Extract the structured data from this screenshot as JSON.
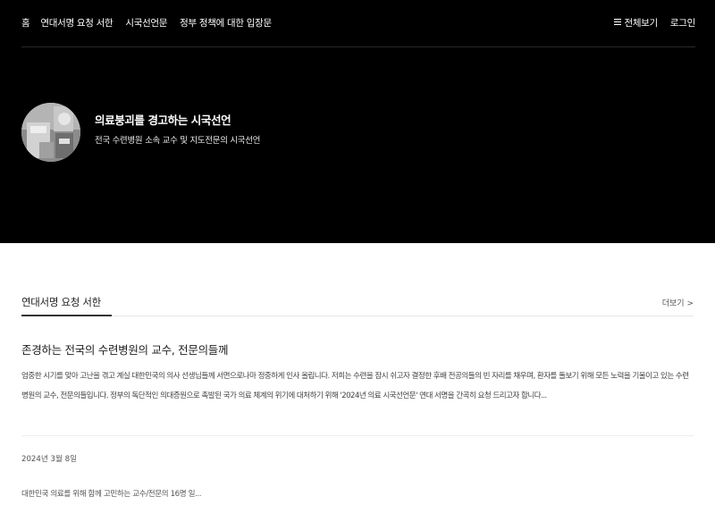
{
  "nav": {
    "home": "홈",
    "items": [
      "연대서명 요청 서한",
      "시국선언문",
      "정부 정책에 대한 입장문"
    ],
    "menu_label": "전체보기",
    "login": "로그인"
  },
  "hero": {
    "title": "의료붕괴를 경고하는 시국선언",
    "subtitle": "전국 수련병원 소속 교수 및 지도전문의 시국선언"
  },
  "section": {
    "title": "연대서명 요청 서한",
    "more": "더보기 >"
  },
  "post": {
    "title": "존경하는 전국의 수련병원의 교수, 전문의들께",
    "excerpt": "엄중한 시기를 맞아 고난을 겪고 계실 대한민국의 의사 선생님들께 서면으로나마 정중하게 인사 올립니다. 저희는 수련을 잠시 쉬고자 결정한 후배 전공의들의 빈 자리를 채우며, 환자를 돌보기 위해 모든 노력을 기울이고 있는 수련병원의 교수, 전문의들입니다. 정부의 독단적인 의대증원으로 촉발된 국가 의료 체계의 위기에 대처하기 위해 '2024년 의료 시국선언문' 연대 서명을 간곡히 요청 드리고자 합니다...",
    "date": "2024년 3월 8일",
    "footer": "대한민국 의료를 위해 함께 고민하는 교수/전문의 16명 일..."
  },
  "colors": {
    "hero_background": "#000000",
    "page_background": "#ffffff"
  }
}
